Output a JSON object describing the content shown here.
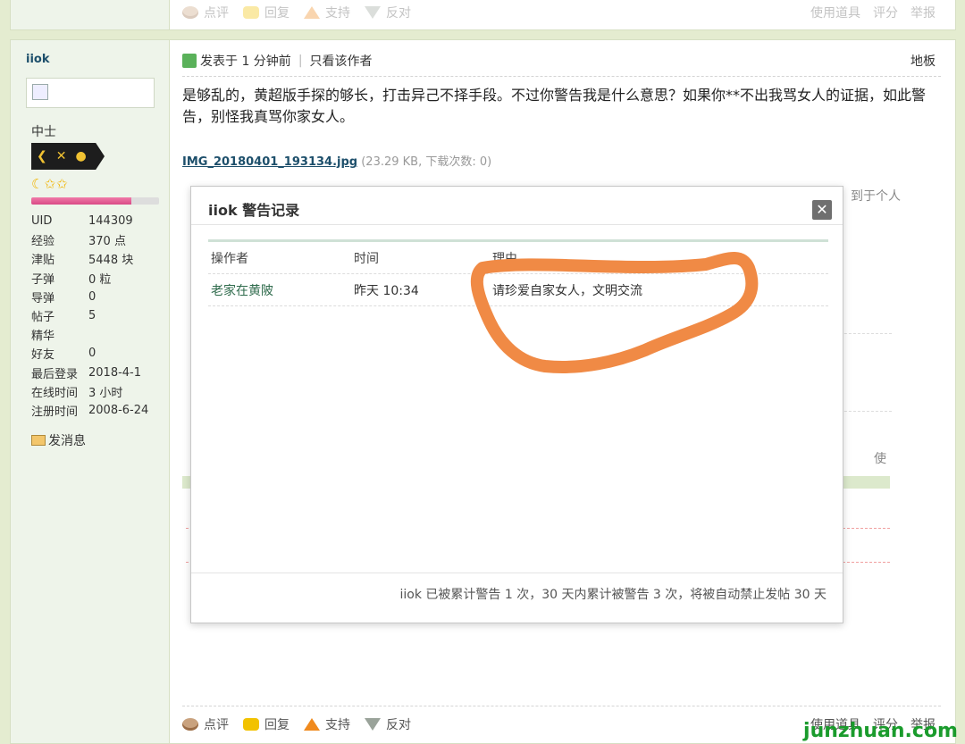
{
  "prev_actions": {
    "comment": "点评",
    "reply": "回复",
    "support": "支持",
    "oppose": "反对",
    "use_tool": "使用道具",
    "rate": "评分",
    "report": "举报"
  },
  "author": {
    "name": "iiok",
    "rank": "中士",
    "stars": "☾✩✩",
    "progress": 0.78,
    "stats": [
      {
        "label": "UID",
        "value": "144309"
      },
      {
        "label": "经验",
        "value": "370 点"
      },
      {
        "label": "津贴",
        "value": "5448 块"
      },
      {
        "label": "子弹",
        "value": "0 粒"
      },
      {
        "label": "导弹",
        "value": "0"
      },
      {
        "label": "帖子",
        "value": "5"
      },
      {
        "label": "精华",
        "value": ""
      },
      {
        "label": "好友",
        "value": "0"
      },
      {
        "label": "最后登录",
        "value": "2018-4-1"
      },
      {
        "label": "在线时间",
        "value": "3 小时"
      },
      {
        "label": "注册时间",
        "value": "2008-6-24"
      }
    ],
    "send_message": "发消息"
  },
  "post": {
    "posted": "发表于 1 分钟前",
    "only_author": "只看该作者",
    "floor": "地板",
    "text": "是够乱的，黄超版手探的够长，打击异己不择手段。不过你警告我是什么意思？如果你**不出我骂女人的证据，如此警告，别怪我真骂你家女人。",
    "attachment_name": "IMG_20180401_193134.jpg",
    "attachment_meta": "(23.29 KB, 下载次数: 0)",
    "ghost_text": "到于个人",
    "ghost_use": "使"
  },
  "dialog": {
    "title": "iiok 警告记录",
    "close": "✕",
    "headers": [
      "操作者",
      "时间",
      "理由"
    ],
    "rows": [
      {
        "operator": "老家在黄陂",
        "time": "昨天 10:34",
        "reason": "请珍爱自家女人，文明交流"
      }
    ],
    "note": "iiok 已被累计警告 1 次，30 天内累计被警告 3 次，将被自动禁止发帖 30 天"
  },
  "bottom_actions": {
    "comment": "点评",
    "reply": "回复",
    "support": "支持",
    "oppose": "反对",
    "use_tool": "使用道具",
    "rate": "评分",
    "report": "举报"
  },
  "watermark": "junzhuan.com",
  "colors": {
    "page_bg": "#e4ecd0",
    "sidebar_bg": "#eef4ea",
    "link": "#1d4f6b",
    "scribble": "#f08a45"
  }
}
